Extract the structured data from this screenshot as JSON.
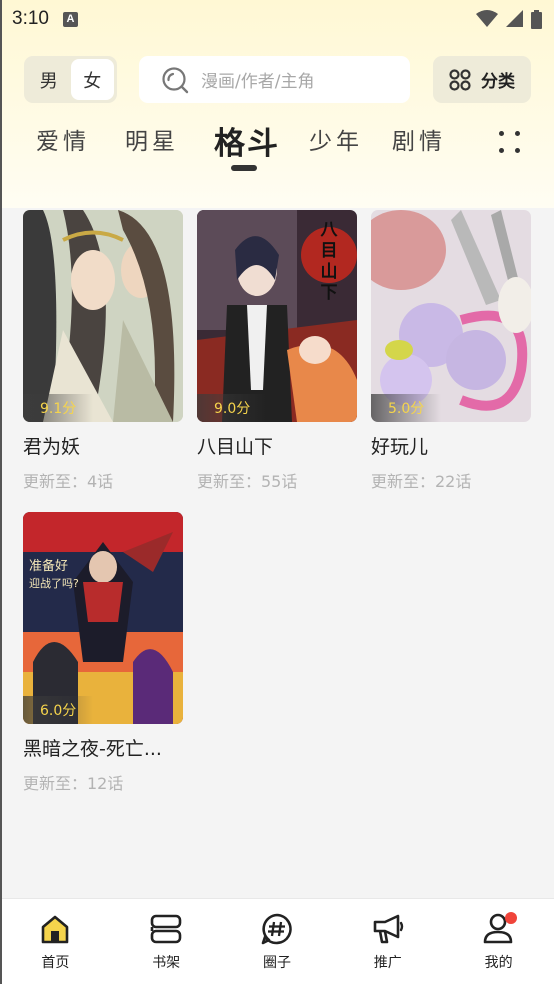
{
  "status_bar": {
    "time": "3:10",
    "notification": "A"
  },
  "header": {
    "gender": {
      "options": [
        "男",
        "女"
      ],
      "selected": "女"
    },
    "search": {
      "placeholder": "漫画/作者/主角"
    },
    "category_button": "分类"
  },
  "tabs": {
    "items": [
      "爱情",
      "明星",
      "格斗",
      "少年",
      "剧情"
    ],
    "active": "格斗"
  },
  "comics": [
    {
      "title": "君为妖",
      "score": "9.1分",
      "update": "更新至：4话"
    },
    {
      "title": "八目山下",
      "score": "9.0分",
      "update": "更新至：55话",
      "cover_text": "八目山下"
    },
    {
      "title": "好玩儿",
      "score": "5.0分",
      "update": "更新至：22话"
    },
    {
      "title": "黑暗之夜-死亡...",
      "score": "6.0分",
      "update": "更新至：12话"
    }
  ],
  "bottom_nav": [
    {
      "label": "首页",
      "icon": "home-icon",
      "active": true
    },
    {
      "label": "书架",
      "icon": "bookshelf-icon"
    },
    {
      "label": "圈子",
      "icon": "hashtag-circle-icon"
    },
    {
      "label": "推广",
      "icon": "megaphone-icon"
    },
    {
      "label": "我的",
      "icon": "user-icon",
      "badge": true
    }
  ],
  "colors": {
    "accent_yellow": "#f5d44c",
    "score_text": "#f5d44c",
    "badge_red": "#f0443a",
    "header_bg": "#fff8d4"
  }
}
